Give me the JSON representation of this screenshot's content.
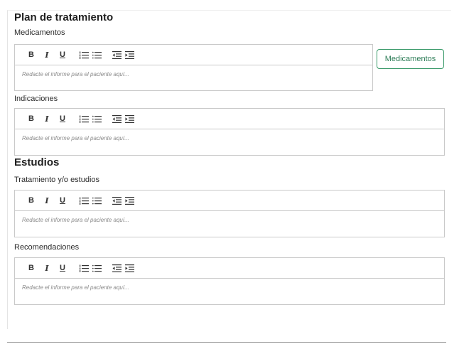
{
  "plan": {
    "title": "Plan de tratamiento",
    "medicamentos_label": "Medicamentos",
    "medicamentos_button": "Medicamentos",
    "indicaciones_label": "Indicaciones"
  },
  "estudios": {
    "title": "Estudios",
    "tratamiento_label": "Tratamiento y/o estudios",
    "recomendaciones_label": "Recomendaciones"
  },
  "editor": {
    "bold": "B",
    "italic": "I",
    "underline": "U",
    "placeholder": "Redacte el informe para el paciente aquí..."
  },
  "icons": [
    "ordered-list-icon",
    "bullet-list-icon",
    "outdent-icon",
    "indent-icon"
  ]
}
